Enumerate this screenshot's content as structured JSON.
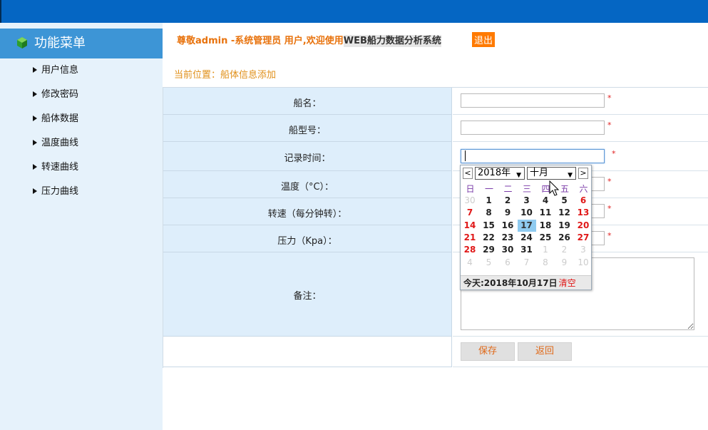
{
  "menu": {
    "title": "功能菜单",
    "items": [
      "用户信息",
      "修改密码",
      "船体数据",
      "温度曲线",
      "转速曲线",
      "压力曲线"
    ]
  },
  "welcome": {
    "prefix": "尊敬admin -系统管理员 用户,欢迎使用",
    "system_name": "WEB船力数据分析系统",
    "logout": "退出"
  },
  "breadcrumb": "当前位置：船体信息添加",
  "form": {
    "fields": [
      {
        "label": "船名：",
        "value": "",
        "required": "*"
      },
      {
        "label": "船型号：",
        "value": "",
        "required": "*"
      },
      {
        "label": "记录时间：",
        "value": "",
        "required": "*"
      },
      {
        "label": "温度（°C）：",
        "value": "",
        "required": "*"
      },
      {
        "label": "转速（每分钟转）：",
        "value": "",
        "required": "*"
      },
      {
        "label": "压力（Kpa）：",
        "value": "",
        "required": "*"
      }
    ],
    "remark_label": "备注：",
    "remark_value": "",
    "save": "保存",
    "back": "返回"
  },
  "datepicker": {
    "prev": "<",
    "next": ">",
    "year": "2018年",
    "month": "十月",
    "weekdays": [
      "日",
      "一",
      "二",
      "三",
      "四",
      "五",
      "六"
    ],
    "days": [
      "30",
      "1",
      "2",
      "3",
      "4",
      "5",
      "6",
      "7",
      "8",
      "9",
      "10",
      "11",
      "12",
      "13",
      "14",
      "15",
      "16",
      "17",
      "18",
      "19",
      "20",
      "21",
      "22",
      "23",
      "24",
      "25",
      "26",
      "27",
      "28",
      "29",
      "30",
      "31",
      "1",
      "2",
      "3",
      "4",
      "5",
      "6",
      "7",
      "8",
      "9",
      "10"
    ],
    "today_label": "今天:2018年10月17日",
    "clear": "清空"
  },
  "colors": {
    "topbar": "#0566c3",
    "accent_orange": "#e8720c",
    "required_red": "#e02020"
  }
}
